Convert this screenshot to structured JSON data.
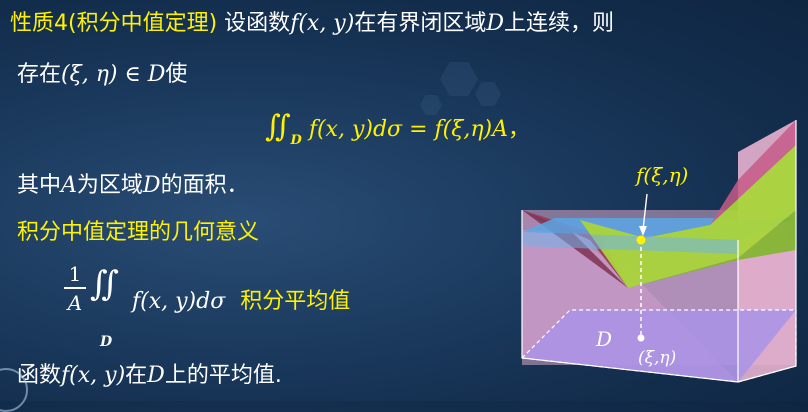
{
  "title_bar": {
    "theorem_label": "性质4(积分中值定理)",
    "intro_text": "设函数",
    "func": "f(x, y)",
    "text_bounded": "在有界闭区域",
    "domain_symbol": "D",
    "text_continuous": "上连续，则"
  },
  "line2": {
    "text_exists": "存在",
    "point": "(ξ, η)",
    "in_symbol": "∈",
    "domain_symbol": "D",
    "text_makes": "使"
  },
  "formula": {
    "integral_sign": "∬",
    "subscript": "D",
    "left_side": "f(x, y)dσ",
    "equals": "=",
    "right_side": "f(ξ,η)A",
    "trailing_comma": "，"
  },
  "area_note": {
    "text_where": "其中",
    "area_symbol": "A",
    "text_is": "为区域",
    "domain_symbol": "D",
    "text_area": "的面积．"
  },
  "geometric_heading": "积分中值定理的几何意义",
  "average_formula": {
    "numerator": "1",
    "denominator": "A",
    "integral_sign": "∬",
    "subscript": "D",
    "integrand": "f(x, y)dσ",
    "label": "积分平均值"
  },
  "last_line": {
    "text_function": "函数",
    "func": "f(x, y)",
    "text_in": "在",
    "domain_symbol": "D",
    "text_average": "上的平均值."
  },
  "figure": {
    "value_label": "f(ξ,η)",
    "domain_label": "D",
    "point_label": "(ξ,η)"
  },
  "colors": {
    "background": "#1b3a5e",
    "text": "#ffffff",
    "highlight": "#fff200",
    "surface_green": "#a9d43a",
    "plane_blue": "#5aa7e6",
    "box_pink": "#e8b3d0"
  }
}
